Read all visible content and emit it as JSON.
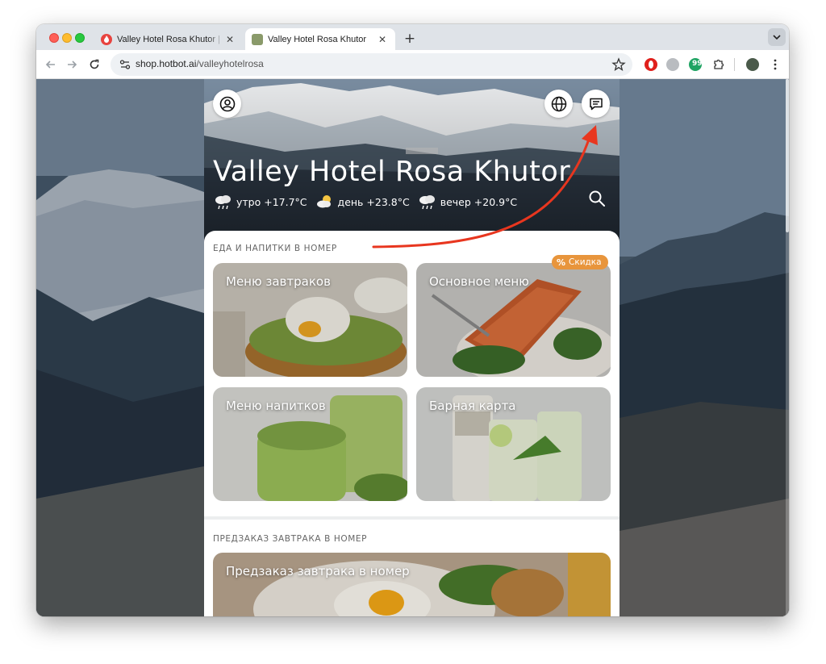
{
  "browser": {
    "tabs": [
      {
        "title": "Valley Hotel Rosa Khutor | Ho",
        "active": false
      },
      {
        "title": "Valley Hotel Rosa Khutor",
        "active": true
      }
    ],
    "url_host": "shop.hotbot.ai",
    "url_path": "/valleyhotelrosa"
  },
  "hero": {
    "title": "Valley Hotel Rosa Khutor",
    "weather": [
      {
        "period": "утро",
        "temp": "+17.7°C",
        "icon": "rain-cloud-icon"
      },
      {
        "period": "день",
        "temp": "+23.8°C",
        "icon": "sun-cloud-icon"
      },
      {
        "period": "вечер",
        "temp": "+20.9°C",
        "icon": "rain-cloud-icon"
      }
    ]
  },
  "sections": [
    {
      "title": "ЕДА И НАПИТКИ В НОМЕР",
      "cards": [
        {
          "label": "Меню завтраков"
        },
        {
          "label": "Основное меню",
          "badge": "Скидка"
        },
        {
          "label": "Меню напитков"
        },
        {
          "label": "Барная карта"
        }
      ]
    },
    {
      "title": "ПРЕДЗАКАЗ ЗАВТРАКА В НОМЕР",
      "cards": [
        {
          "label": "Предзаказ завтрака в номер"
        }
      ]
    }
  ],
  "colors": {
    "badge": "#e8953c",
    "annotation_arrow": "#e8361f"
  }
}
